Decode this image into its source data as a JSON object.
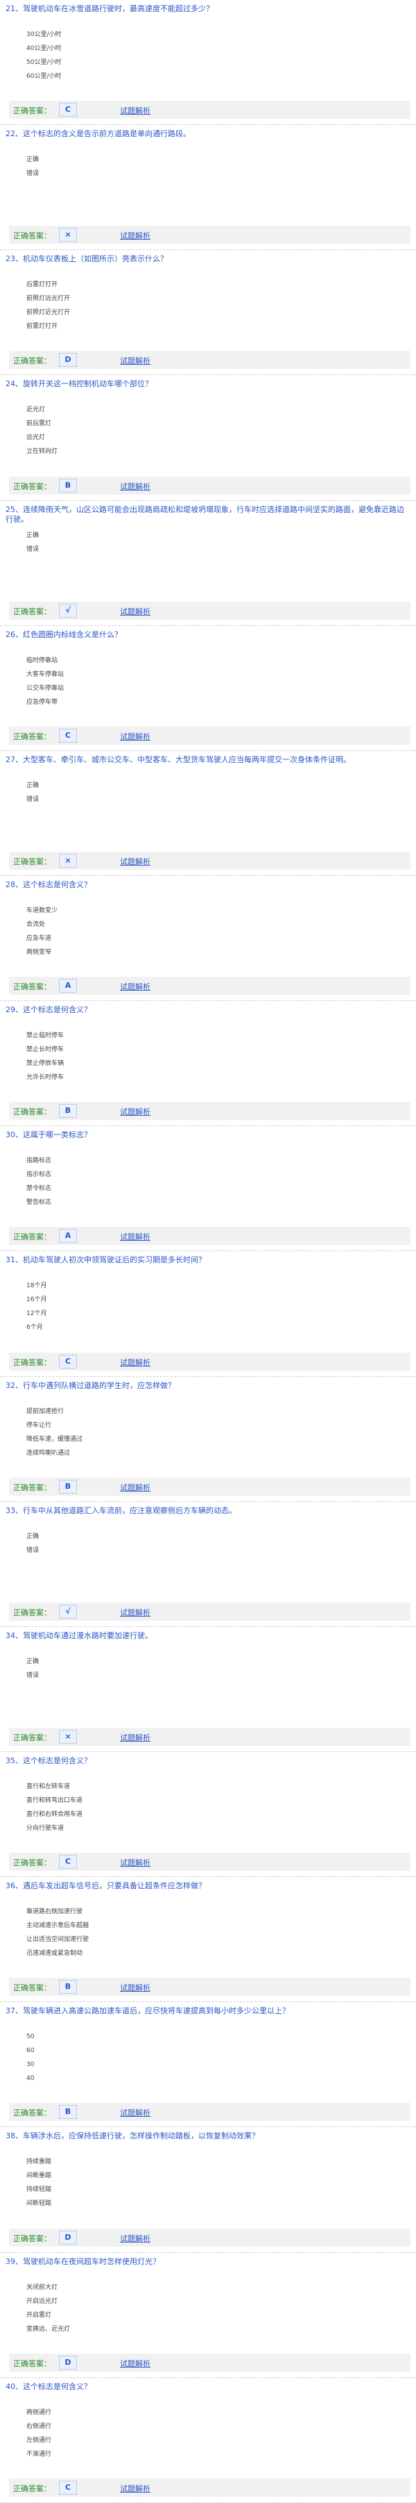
{
  "answer_label": "正确答案：",
  "explain_label": "试题解析",
  "questions": [
    {
      "title": "21、驾驶机动车在冰雪道路行驶时，最高速度不能超过多少？",
      "options": [
        "30公里/小时",
        "40公里/小时",
        "50公里/小时",
        "60公里/小时"
      ],
      "answer": "C"
    },
    {
      "title": "22、这个标志的含义是告示前方道路是单向通行路段。",
      "options": [
        "正确",
        "错误"
      ],
      "answer": "×"
    },
    {
      "title": "23、机动车仪表板上（如图所示）亮表示什么？",
      "options": [
        "后雾灯打开",
        "前照灯远光打开",
        "前照灯近光打开",
        "前雾灯打开"
      ],
      "answer": "D"
    },
    {
      "title": "24、旋转开关这一档控制机动车哪个部位？",
      "options": [
        "近光灯",
        "前后雾灯",
        "远光灯",
        "立在转向灯"
      ],
      "answer": "B"
    },
    {
      "title": "25、连续降雨天气，山区公路可能会出现路肩疏松和堤坡坍塌现象，行车时应选择道路中间坚实的路面，避免靠近路边行驶。",
      "options": [
        "正确",
        "错误"
      ],
      "answer": "√"
    },
    {
      "title": "26、红色圆圈内标线含义是什么？",
      "options": [
        "临时停靠站",
        "大客车停靠站",
        "公交车停靠站",
        "应急停车带"
      ],
      "answer": "C"
    },
    {
      "title": "27、大型客车、牵引车、城市公交车、中型客车、大型货车驾驶人应当每两年提交一次身体条件证明。",
      "options": [
        "正确",
        "错误"
      ],
      "answer": "×"
    },
    {
      "title": "28、这个标志是何含义？",
      "options": [
        "车道数变少",
        "合流处",
        "应急车道",
        "两侧变窄"
      ],
      "answer": "A"
    },
    {
      "title": "29、这个标志是何含义？",
      "options": [
        "禁止临时停车",
        "禁止长时停车",
        "禁止停放车辆",
        "允许长时停车"
      ],
      "answer": "B"
    },
    {
      "title": "30、这属于哪一类标志？",
      "options": [
        "指路标志",
        "指示标志",
        "禁令标志",
        "警告标志"
      ],
      "answer": "A"
    },
    {
      "title": "31、机动车驾驶人初次申领驾驶证后的实习期是多长时间？",
      "options": [
        "18个月",
        "16个月",
        "12个月",
        "6个月"
      ],
      "answer": "C"
    },
    {
      "title": "32、行车中遇列队横过道路的学生时，应怎样做？",
      "options": [
        "提前加速抢行",
        "停车让行",
        "降低车速，缓慢通过",
        "连续鸣喇叭通过"
      ],
      "answer": "B"
    },
    {
      "title": "33、行车中从其他道路汇入车流前，应注意观察侧后方车辆的动态。",
      "options": [
        "正确",
        "错误"
      ],
      "answer": "√"
    },
    {
      "title": "34、驾驶机动车通过漫水路时要加速行驶。",
      "options": [
        "正确",
        "错误"
      ],
      "answer": "×"
    },
    {
      "title": "35、这个标志是何含义？",
      "options": [
        "直行和左转车道",
        "直行和转弯出口车道",
        "直行和右转合用车道",
        "分向行驶车道"
      ],
      "answer": "C"
    },
    {
      "title": "36、遇后车发出超车信号后，只要具备让超条件应怎样做？",
      "options": [
        "靠道路右侧加速行驶",
        "主动减速示意后车超越",
        "让出适当空间加速行驶",
        "迅速减速或紧急制动"
      ],
      "answer": "B"
    },
    {
      "title": "37、驾驶车辆进入高速公路加速车道后，应尽快将车速提高到每小时多少公里以上？",
      "options": [
        "50",
        "60",
        "30",
        "40"
      ],
      "answer": "B"
    },
    {
      "title": "38、车辆涉水后，应保持低速行驶，怎样操作制动踏板，以恢复制动效果？",
      "options": [
        "持续重踏",
        "间断重踏",
        "持续轻踏",
        "间断轻踏"
      ],
      "answer": "D"
    },
    {
      "title": "39、驾驶机动车在夜间超车时怎样使用灯光？",
      "options": [
        "关闭前大灯",
        "开启远光灯",
        "开启雾灯",
        "变换远、近光灯"
      ],
      "answer": "D"
    },
    {
      "title": "40、这个标志是何含义？",
      "options": [
        "两侧通行",
        "右侧通行",
        "左侧通行",
        "不准通行"
      ],
      "answer": "C"
    }
  ]
}
